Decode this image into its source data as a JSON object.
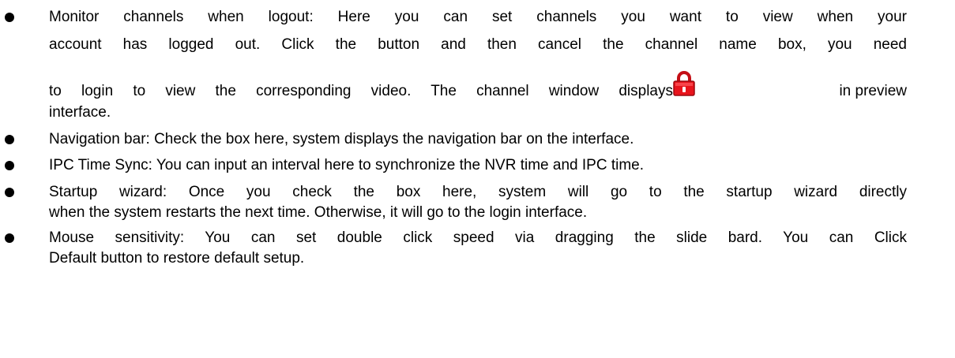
{
  "bullets": [
    {
      "lines": [
        "Monitor channels when logout: Here you can set channels you want to view when your",
        "account has logged out. Click the button and then cancel the channel name box, you need",
        "to login to view the corresponding video. The channel window displays",
        "in preview",
        "interface."
      ]
    },
    {
      "lines": [
        "Navigation bar: Check the box here, system displays the navigation bar on the interface."
      ]
    },
    {
      "lines": [
        "IPC Time Sync: You can input an interval here to synchronize the NVR time and IPC time."
      ]
    },
    {
      "lines": [
        "Startup wizard: Once you check the box here, system will go to the startup wizard directly",
        "when the system restarts the next time. Otherwise, it will go to the login interface."
      ]
    },
    {
      "lines": [
        "Mouse sensitivity: You can set double click speed via dragging the slide bard. You can Click",
        "Default button to restore default setup."
      ]
    }
  ],
  "icons": {
    "lock": {
      "name": "lock-icon",
      "color": "#e8141c"
    }
  }
}
